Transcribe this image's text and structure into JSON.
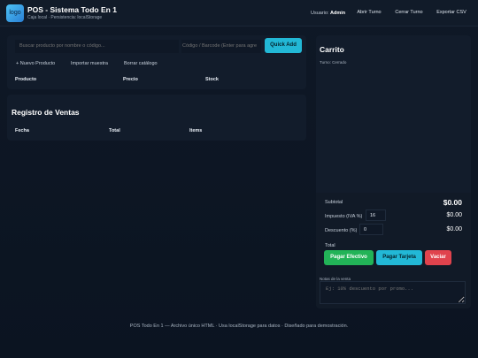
{
  "header": {
    "logo_text": "logo",
    "title": "POS - Sistema Todo En 1",
    "subtitle": "Caja local · Persistencia: localStorage",
    "user_label": "Usuario:",
    "user_name": "Admin",
    "buttons": [
      "Abrir Turno",
      "Cerrar Turno",
      "Exportar CSV"
    ]
  },
  "products": {
    "search_placeholder": "Buscar producto por nombre o código...",
    "barcode_placeholder": "Código / Barcode (Enter para agre",
    "quick_add_label": "Quick Add",
    "tools": [
      "+ Nuevo Producto",
      "Importar muestra",
      "Borrar catálogo"
    ],
    "columns": [
      "Producto",
      "Precio",
      "Stock"
    ]
  },
  "sales": {
    "title": "Registro de Ventas",
    "columns": [
      "Fecha",
      "Total",
      "Items"
    ]
  },
  "cart": {
    "title": "Carrito",
    "shift_status": "Turno: Cerrado",
    "subtotal_label": "Subtotal",
    "subtotal_value": "$0.00",
    "tax_label": "Impuesto (IVA %)",
    "tax_rate": "16",
    "tax_value": "$0.00",
    "discount_label": "Descuento (%)",
    "discount_rate": "0",
    "discount_value": "$0.00",
    "total_label": "Total",
    "pay_cash_label": "Pagar Efectivo",
    "pay_card_label": "Pagar Tarjeta",
    "empty_label": "Vaciar",
    "notes_label": "Notas de la venta",
    "notes_placeholder": "Ej: 10% descuento por promo..."
  },
  "footer": {
    "text": "POS Todo En 1 — Archivo único HTML · Usa localStorage para datos · Diseñado para demostración."
  },
  "colors": {
    "background": "#0f1826",
    "accent_cyan": "#22b8d6",
    "accent_green": "#22b357",
    "accent_red": "#e0434d"
  }
}
